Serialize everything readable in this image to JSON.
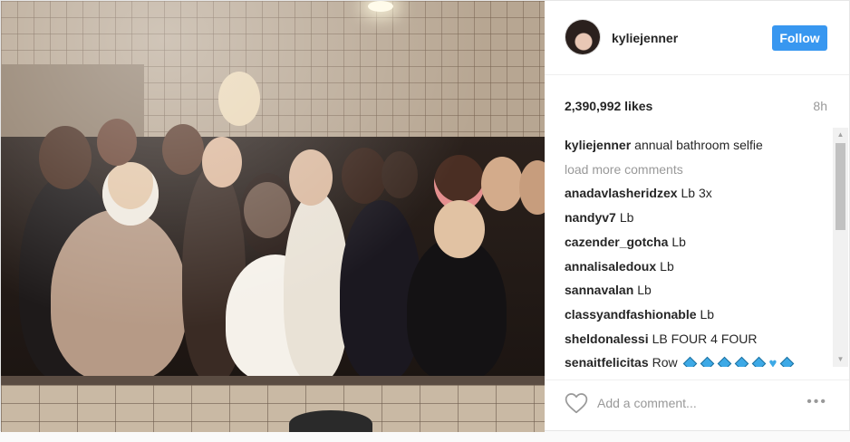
{
  "post": {
    "image_alt": "",
    "author": {
      "username": "kyliejenner",
      "follow_label": "Follow"
    },
    "likes": "2,390,992 likes",
    "time": "8h",
    "caption": {
      "user": "kyliejenner",
      "text": "annual bathroom selfie"
    },
    "load_more": "load more comments",
    "comments": [
      {
        "user": "anadavlasheridzex",
        "text": "Lb 3x"
      },
      {
        "user": "nandyv7",
        "text": "Lb"
      },
      {
        "user": "cazender_gotcha",
        "text": "Lb"
      },
      {
        "user": "annalisaledoux",
        "text": "Lb"
      },
      {
        "user": "sannavalan",
        "text": "Lb"
      },
      {
        "user": "classyandfashionable",
        "text": "Lb"
      },
      {
        "user": "sheldonalessi",
        "text": "LB FOUR 4 FOUR"
      },
      {
        "user": "senaitfelicitas",
        "text": "Row"
      }
    ],
    "comment_emojis": [
      "diamond-icon",
      "diamond-icon",
      "diamond-icon",
      "diamond-icon",
      "diamond-icon",
      "heart-icon",
      "diamond-icon"
    ],
    "add_comment_placeholder": "Add a comment...",
    "more_label": "•••"
  },
  "colors": {
    "follow_blue": "#3897f0",
    "emoji_blue": "#3da9e6",
    "muted_text": "#999999"
  }
}
